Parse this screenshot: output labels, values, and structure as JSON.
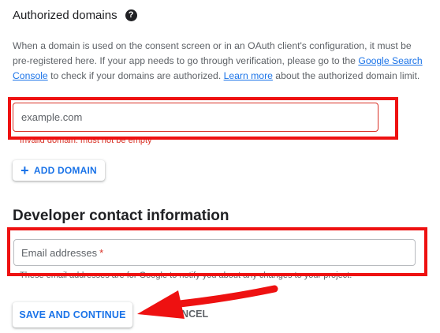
{
  "authorized_domains": {
    "title": "Authorized domains",
    "help_icon": "help-circle-icon",
    "description_part1": "When a domain is used on the consent screen or in an OAuth client's configuration, it must be pre-registered here. If your app needs to go through verification, please go to the ",
    "link_search_console": "Google Search Console",
    "description_part2": " to check if your domains are authorized. ",
    "link_learn_more": "Learn more",
    "description_part3": " about the authorized domain limit.",
    "input_placeholder": "example.com",
    "input_value": "",
    "error_text": "Invalid domain: must not be empty",
    "add_domain_icon": "plus-icon",
    "add_domain_label": "ADD DOMAIN"
  },
  "developer_contact": {
    "title": "Developer contact information",
    "email_label": "Email addresses",
    "required_mark": "*",
    "hint": "These email addresses are for Google to notify you about any changes to your project."
  },
  "footer": {
    "save_label": "SAVE AND CONTINUE",
    "cancel_label": "CANCEL"
  },
  "colors": {
    "accent": "#1a73e8",
    "error": "#d93025",
    "highlight_annotation": "#ee1111"
  }
}
